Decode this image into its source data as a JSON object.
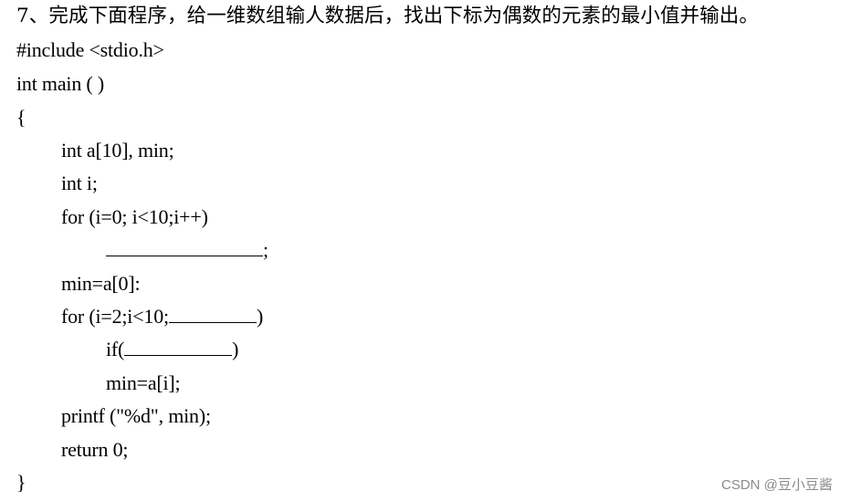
{
  "question": {
    "number": "7、",
    "text": "完成下面程序，给一维数组输人数据后，找出下标为偶数的元素的最小值并输出。"
  },
  "code": {
    "include": "#include <stdio.h>",
    "main_sig": "int main ( )",
    "open_brace": "{",
    "decl_array": "int a[10], min;",
    "decl_i": "int i;",
    "for1": "for (i=0; i<10;i++)",
    "blank1_suffix": ";",
    "min_init": "min=a[0]:",
    "for2_prefix": "for (i=2;i<10;",
    "for2_suffix": ")",
    "if_prefix": "if(",
    "if_suffix": ")",
    "min_assign": "min=a[i];",
    "printf": "printf (\"%d\", min);",
    "return": "return 0;",
    "close_brace": "}"
  },
  "blanks": {
    "blank1": "",
    "blank2": "",
    "blank3": ""
  },
  "watermark": "CSDN @豆小豆酱"
}
